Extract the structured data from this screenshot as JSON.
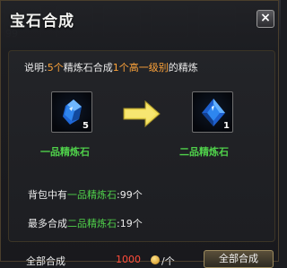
{
  "window": {
    "title": "宝石合成",
    "close_label": "×",
    "background_slot_number": "99"
  },
  "description": {
    "prefix": "说明:",
    "count_from": "5个",
    "mid1": "精炼石合成",
    "count_to": "1个",
    "quality": "高一级别",
    "suffix": "的精炼"
  },
  "source_item": {
    "name": "一品精炼石",
    "quantity": "5",
    "icon": "blue-crystal-icon"
  },
  "result_item": {
    "name": "二品精炼石",
    "quantity": "1",
    "icon": "blue-gem-icon"
  },
  "stats": {
    "owned_prefix": "背包中有",
    "owned_item": "一品精炼石",
    "owned_value": ":99个",
    "max_prefix": "最多合成",
    "max_item": "二品精炼石",
    "max_value": ":19个"
  },
  "footer": {
    "label": "全部合成",
    "amount": "1000",
    "per": "/个",
    "button_label": "全部合成"
  },
  "colors": {
    "highlight_orange": "#ffa43a",
    "highlight_green": "#4fd04a",
    "cost_red": "#ff4b3a",
    "arrow_yellow": "#f3df58"
  }
}
